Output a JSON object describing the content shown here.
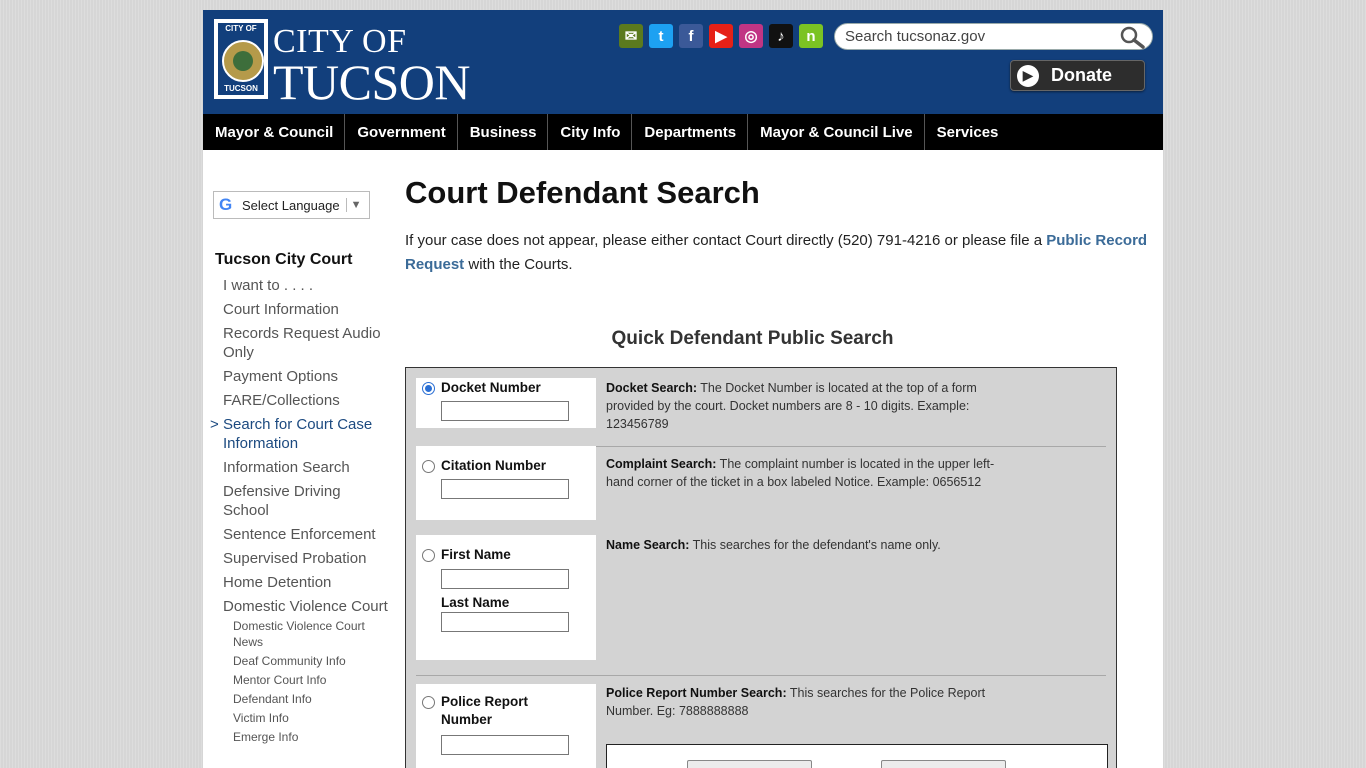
{
  "header": {
    "logo": {
      "seal_top": "CITY OF",
      "seal_bottom": "TUCSON",
      "line1": "CITY OF",
      "line2": "TUCSON"
    },
    "social_icons": [
      {
        "name": "email-icon",
        "glyph": "✉",
        "color": "#5b7a1e"
      },
      {
        "name": "twitter-icon",
        "glyph": "t",
        "color": "#1da1f2"
      },
      {
        "name": "facebook-icon",
        "glyph": "f",
        "color": "#3b5998"
      },
      {
        "name": "youtube-icon",
        "glyph": "▶",
        "color": "#e62117"
      },
      {
        "name": "instagram-icon",
        "glyph": "◎",
        "color": "#c13584"
      },
      {
        "name": "tiktok-icon",
        "glyph": "♪",
        "color": "#111111"
      },
      {
        "name": "nextdoor-icon",
        "glyph": "n",
        "color": "#7bc323"
      }
    ],
    "search": {
      "placeholder": "Search tucsonaz.gov"
    },
    "donate_label": "Donate"
  },
  "nav": {
    "items": [
      "Mayor & Council",
      "Government",
      "Business",
      "City Info",
      "Departments",
      "Mayor & Council Live",
      "Services"
    ]
  },
  "sidebar": {
    "language": "Select Language",
    "title": "Tucson City Court",
    "items": [
      "I want to . . . .",
      "Court Information",
      "Records Request Audio Only",
      "Payment Options",
      "FARE/Collections",
      "Search for Court Case Information",
      "Information Search",
      "Defensive Driving School",
      "Sentence Enforcement",
      "Supervised Probation",
      "Home Detention",
      "Domestic Violence Court"
    ],
    "subitems": [
      "Domestic Violence Court News",
      "Deaf Community Info",
      "Mentor Court Info",
      "Defendant Info",
      "Victim Info",
      "Emerge Info"
    ]
  },
  "main": {
    "title": "Court Defendant Search",
    "intro_text": "If your case does not appear, please either contact Court directly (520) 791-4216 or please file a ",
    "intro_link": "Public Record Request",
    "intro_suffix": " with the Courts.",
    "form_title": "Quick Defendant Public Search",
    "rows": {
      "docket": {
        "label": "Docket Number",
        "desc_title": "Docket Search:",
        "desc": " The Docket Number is located at the top of a form provided by the court. Docket numbers are 8 - 10 digits. Example: 123456789",
        "selected": true
      },
      "citation": {
        "label": "Citation Number",
        "desc_title": "Complaint Search:",
        "desc": " The complaint number is located in the upper left-hand corner of the ticket in a box labeled Notice. Example: 0656512"
      },
      "name": {
        "first_label": "First Name",
        "last_label": "Last Name",
        "desc_title": "Name Search:",
        "desc": " This searches for the defendant's name only."
      },
      "police": {
        "label": "Police Report Number",
        "desc_title": "Police Report Number Search:",
        "desc": " This searches for the Police Report Number. Eg: 7888888888"
      }
    }
  }
}
